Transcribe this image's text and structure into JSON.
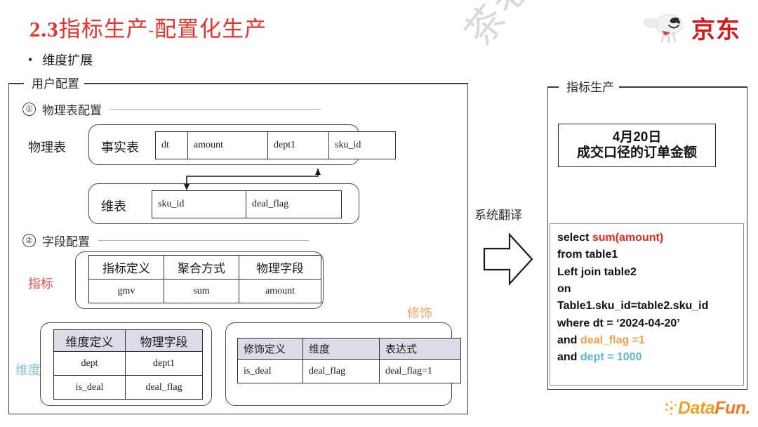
{
  "slide": {
    "title_number": "2.3",
    "title_text": "指标生产",
    "title_dash": "-",
    "title_text2": "配置化生产",
    "bullet": "维度扩展",
    "watermark": "茶老李"
  },
  "brand": {
    "jd_label": "京东",
    "jd_icon": "jd-dog-icon",
    "datafun_head": "Data",
    "datafun_tail": "Fun.",
    "jd_red": "#d7191c",
    "datafun_orange": "#ef7b22"
  },
  "left_panel": {
    "legend": "用户配置",
    "sections": [
      {
        "number": "①",
        "label": "物理表配置"
      },
      {
        "number": "②",
        "label": "字段配置"
      }
    ],
    "physical_group_label": "物理表",
    "fact_table": {
      "row_label": "事实表",
      "columns": [
        "dt",
        "amount",
        "dept1",
        "sku_id"
      ]
    },
    "dim_table": {
      "row_label": "维表",
      "columns": [
        "sku_id",
        "deal_flag"
      ]
    },
    "metric_label": "指标",
    "metric_table": {
      "headers": [
        "指标定义",
        "聚合方式",
        "物理字段"
      ],
      "rows": [
        [
          "gmv",
          "sum",
          "amount"
        ]
      ]
    },
    "dimension_label": "维度",
    "dimension_table": {
      "headers": [
        "维度定义",
        "物理字段"
      ],
      "rows": [
        [
          "dept",
          "dept1"
        ],
        [
          "is_deal",
          "deal_flag"
        ]
      ]
    },
    "modifier_label": "修饰",
    "modifier_table": {
      "headers": [
        "修饰定义",
        "维度",
        "表达式"
      ],
      "rows": [
        [
          "is_deal",
          "deal_flag",
          "deal_flag=1"
        ]
      ]
    }
  },
  "middle": {
    "translate_label": "系统翻译",
    "arrow_icon": "right-block-arrow-icon"
  },
  "right_panel": {
    "legend": "指标生产",
    "result": {
      "line1": "4月20日",
      "line2": "成交口径的订单金额"
    },
    "sql_lines": [
      [
        {
          "t": "select ",
          "c": "plain"
        },
        {
          "t": "sum(amount)",
          "c": "red"
        }
      ],
      [
        {
          "t": "from table1",
          "c": "plain"
        }
      ],
      [
        {
          "t": "Left join table2",
          "c": "plain"
        }
      ],
      [
        {
          "t": "on",
          "c": "plain"
        }
      ],
      [
        {
          "t": "Table1.sku_id=table2.sku_id",
          "c": "plain"
        }
      ],
      [
        {
          "t": "where dt = ‘2024-04-20’",
          "c": "plain"
        }
      ],
      [
        {
          "t": "and ",
          "c": "plain"
        },
        {
          "t": "deal_flag =1",
          "c": "orange"
        }
      ],
      [
        {
          "t": "and ",
          "c": "plain"
        },
        {
          "t": "dept = 1000",
          "c": "blue"
        }
      ]
    ],
    "sql_colors": {
      "red": "#e8241c",
      "orange": "#f0a14a",
      "blue": "#5bb6cf"
    }
  }
}
